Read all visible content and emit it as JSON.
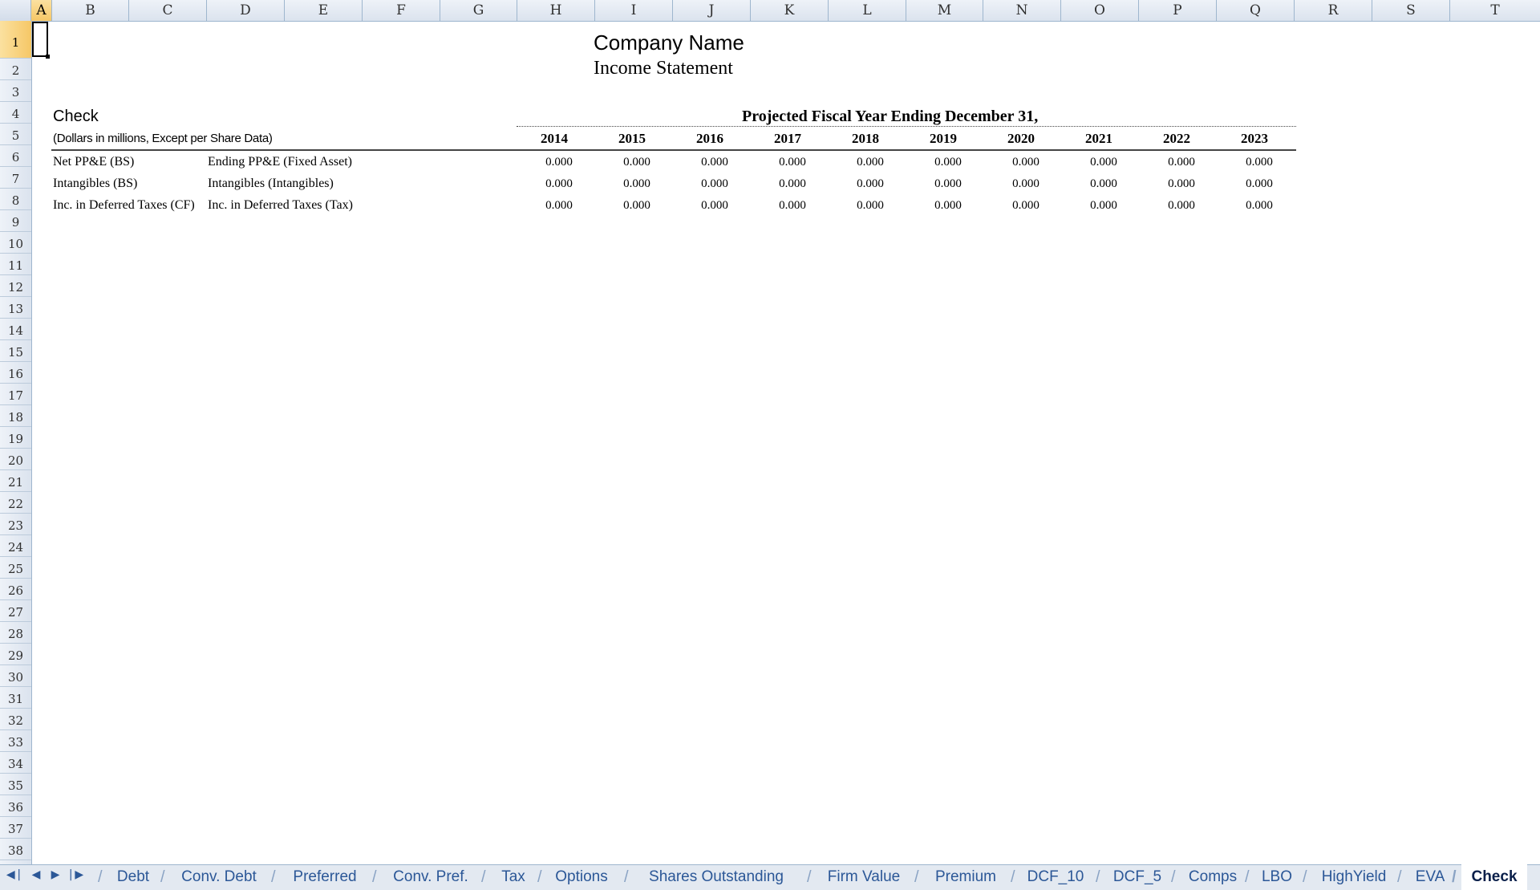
{
  "columns": [
    "A",
    "B",
    "C",
    "D",
    "E",
    "F",
    "G",
    "H",
    "I",
    "J",
    "K",
    "L",
    "M",
    "N",
    "O",
    "P",
    "Q",
    "R",
    "S",
    "T"
  ],
  "rows": [
    "1",
    "2",
    "3",
    "4",
    "5",
    "6",
    "7",
    "8",
    "9",
    "10",
    "11",
    "12",
    "13",
    "14",
    "15",
    "16",
    "17",
    "18",
    "19",
    "20",
    "21",
    "22",
    "23",
    "24",
    "25",
    "26",
    "27",
    "28",
    "29",
    "30",
    "31",
    "32",
    "33",
    "34",
    "35",
    "36",
    "37",
    "38"
  ],
  "sheet": {
    "company_name": "Company Name",
    "statement": "Income Statement",
    "check_label": "Check",
    "units_note": "(Dollars in millions, Except per Share Data)",
    "projection_header": "Projected Fiscal Year Ending December 31,",
    "years": [
      "2014",
      "2015",
      "2016",
      "2017",
      "2018",
      "2019",
      "2020",
      "2021",
      "2022",
      "2023"
    ],
    "line_items": [
      {
        "label": "Net PP&E (BS)",
        "compare": "Ending PP&E (Fixed Asset)",
        "values": [
          "0.000",
          "0.000",
          "0.000",
          "0.000",
          "0.000",
          "0.000",
          "0.000",
          "0.000",
          "0.000",
          "0.000"
        ]
      },
      {
        "label": "Intangibles (BS)",
        "compare": "Intangibles (Intangibles)",
        "values": [
          "0.000",
          "0.000",
          "0.000",
          "0.000",
          "0.000",
          "0.000",
          "0.000",
          "0.000",
          "0.000",
          "0.000"
        ]
      },
      {
        "label": "Inc. in Deferred Taxes (CF)",
        "compare": "Inc. in Deferred Taxes (Tax)",
        "values": [
          "0.000",
          "0.000",
          "0.000",
          "0.000",
          "0.000",
          "0.000",
          "0.000",
          "0.000",
          "0.000",
          "0.000"
        ]
      }
    ]
  },
  "tabs": [
    "Debt",
    "Conv. Debt",
    "Preferred",
    "Conv. Pref.",
    "Tax",
    "Options",
    "Shares Outstanding",
    "Firm Value",
    "Premium",
    "DCF_10",
    "DCF_5",
    "Comps",
    "LBO",
    "HighYield",
    "EVA",
    "Check"
  ],
  "active_tab": "Check",
  "active_cell": "A1",
  "nav_icons": [
    "first-sheet-icon",
    "prev-sheet-icon",
    "next-sheet-icon",
    "last-sheet-icon"
  ]
}
